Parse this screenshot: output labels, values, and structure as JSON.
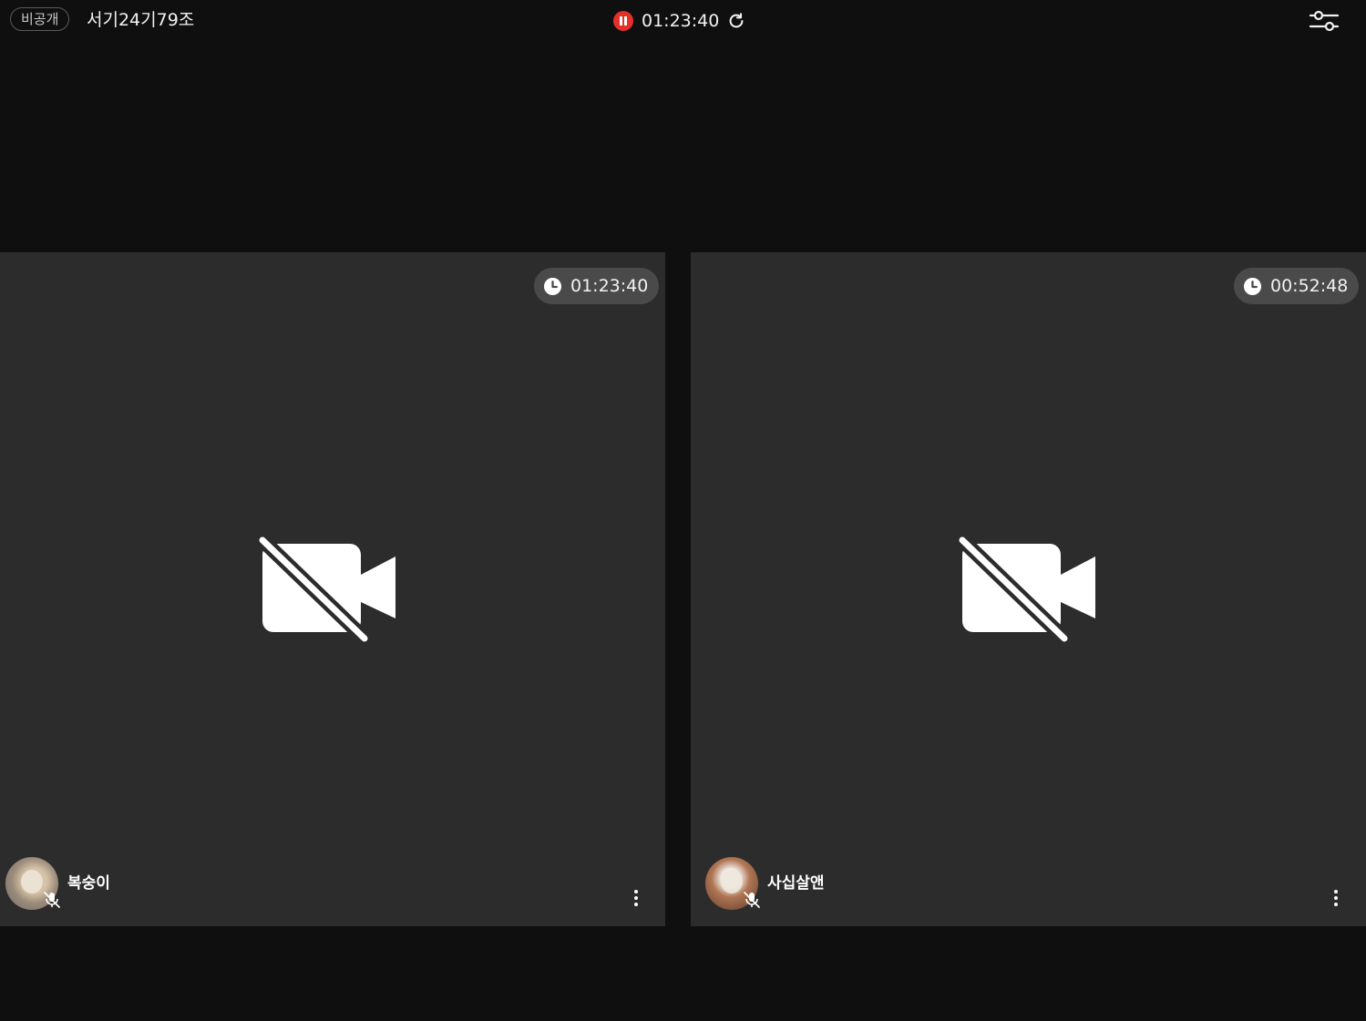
{
  "header": {
    "privacy_label": "비공개",
    "room_title": "서기24기79조",
    "recording_time": "01:23:40",
    "icons": {
      "pause": "pause-icon",
      "refresh": "refresh-icon",
      "settings": "settings-sliders-icon"
    },
    "colors": {
      "recording": "#e5302a"
    }
  },
  "participants": [
    {
      "name": "복숭이",
      "elapsed": "01:23:40",
      "camera": "off",
      "mic": "off"
    },
    {
      "name": "사십살앤",
      "elapsed": "00:52:48",
      "camera": "off",
      "mic": "off"
    }
  ],
  "theme": {
    "background": "#0f0f0f",
    "tile": "#2c2c2c",
    "pill": "#4a4a4a"
  }
}
